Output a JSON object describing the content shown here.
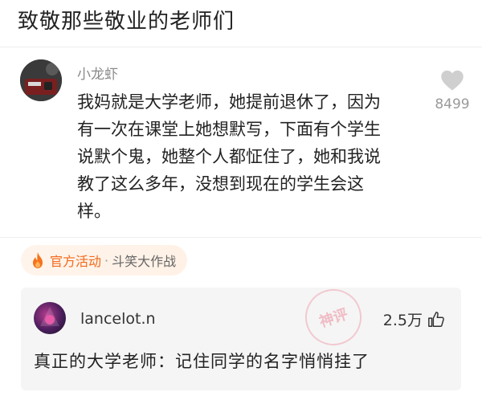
{
  "page": {
    "title": "致敬那些敬业的老师们"
  },
  "post": {
    "username": "小龙虾",
    "content": "我妈就是大学老师，她提前退休了，因为\n有一次在课堂上她想默写，下面有个学生\n说默个鬼，她整个人都怔住了，她和我说\n教了这么多年，没想到现在的学生会这\n样。",
    "like_count": "8499"
  },
  "activity": {
    "label": "官方活动",
    "separator": "·",
    "event": "斗笑大作战"
  },
  "reply": {
    "username": "lancelot.n",
    "like_count": "2.5万",
    "content": "真正的大学老师：记住同学的名字悄悄挂了"
  },
  "watermark": {
    "text": "神评"
  },
  "colors": {
    "accent": "#f26a1b",
    "muted": "#8a8a8a",
    "reply_bg": "#f5f5f5"
  }
}
